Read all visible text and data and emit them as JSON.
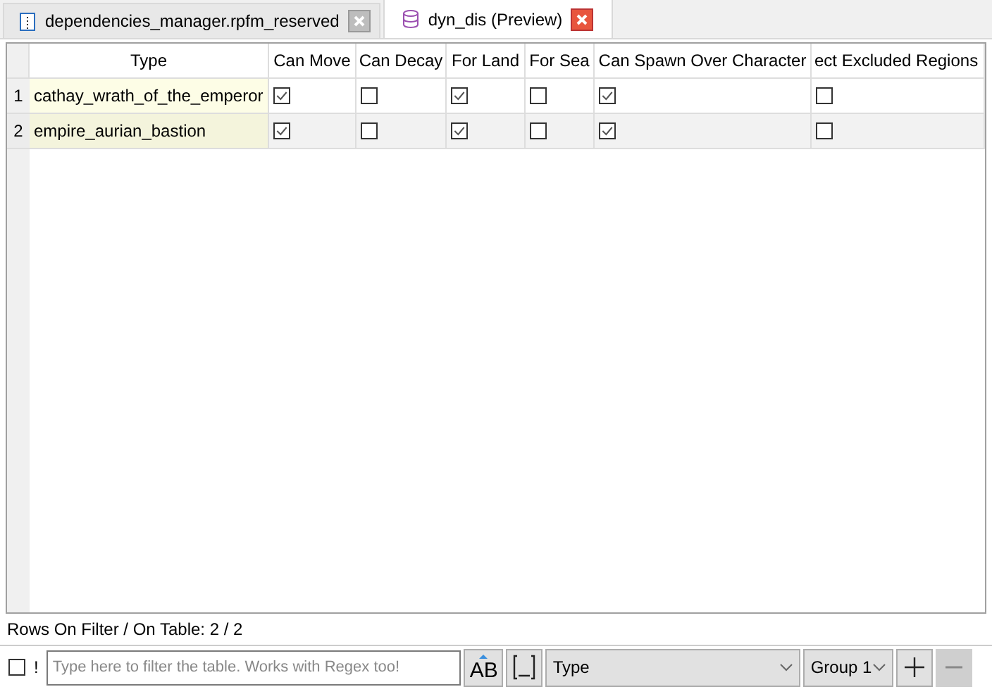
{
  "tabs": [
    {
      "label": "dependencies_manager.rpfm_reserved",
      "kind": "file",
      "selected": false
    },
    {
      "label": "dyn_dis (Preview)",
      "kind": "table",
      "selected": true
    }
  ],
  "table": {
    "columns": [
      "Type",
      "Can Move",
      "Can Decay",
      "For Land",
      "For Sea",
      "Can Spawn Over Character",
      "ect Excluded Regions"
    ],
    "rows": [
      {
        "number": "1",
        "type": "cathay_wrath_of_the_emperor",
        "checks": [
          {
            "checked": true
          },
          {
            "checked": false
          },
          {
            "checked": true
          },
          {
            "checked": false
          },
          {
            "checked": true
          },
          {
            "checked": false
          }
        ]
      },
      {
        "number": "2",
        "type": "empire_aurian_bastion",
        "checks": [
          {
            "checked": true
          },
          {
            "checked": false
          },
          {
            "checked": true
          },
          {
            "checked": false
          },
          {
            "checked": true
          },
          {
            "checked": false
          }
        ]
      }
    ]
  },
  "status": "Rows On Filter / On Table: 2 / 2",
  "filter": {
    "negate_checked": false,
    "negate_label": "!",
    "placeholder": "Type here to filter the table. Works with Regex too!",
    "case_button": "AB",
    "column": "Type",
    "group": "Group 1",
    "add_disabled": false,
    "remove_disabled": true
  }
}
